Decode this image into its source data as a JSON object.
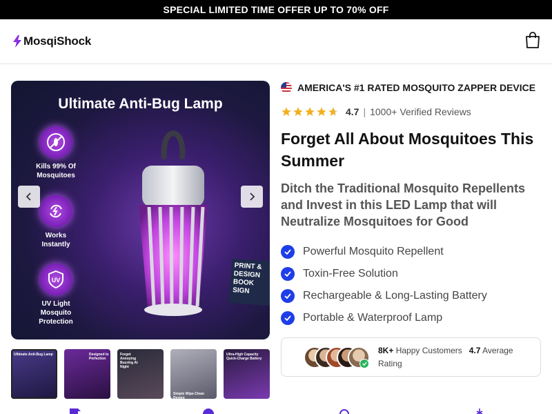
{
  "promo": {
    "text": "SPECIAL LIMITED TIME OFFER UP TO 70% OFF"
  },
  "header": {
    "logo_text": "MosqiShock",
    "logo_icon": "lightning-bolt-icon",
    "cart_icon": "shopping-bag-icon"
  },
  "gallery": {
    "title": "Ultimate Anti-Bug Lamp",
    "features": [
      {
        "label": "Kills 99% Of Mosquitoes",
        "icon": "mosquito-icon"
      },
      {
        "label": "Works Instantly",
        "icon": "refresh-icon"
      },
      {
        "label": "UV Light Mosquito Protection",
        "icon": "uv-shield-icon",
        "badge": "UV"
      }
    ],
    "book_text": "PRINT & DESIGN BOOK SIGN",
    "prev_icon": "chevron-left-icon",
    "next_icon": "chevron-right-icon"
  },
  "thumbnails": [
    {
      "label": "Ultimate Anti-Bug Lamp",
      "active": true,
      "color": "#3b2a6a"
    },
    {
      "label": "Designed to Perfection",
      "active": false,
      "color": "#4a1d6b"
    },
    {
      "label": "Forget Annoying Buzzing At Night",
      "active": false,
      "color": "#1d1d2a"
    },
    {
      "label": "Simple Wipe-Clean Design",
      "active": false,
      "color": "#6a6a7a"
    },
    {
      "label": "Ultra-High Capacity Quick-Charge Battery",
      "active": false,
      "color": "#3a2250"
    }
  ],
  "product": {
    "rated_text": "AMERICA'S #1 RATED MOSQUITO ZAPPER DEVICE",
    "rating": "4.7",
    "rating_value": 4.7,
    "rating_max": 5,
    "reviews_text": "1000+ Verified Reviews",
    "headline": "Forget All About Mosquitoes This Summer",
    "subheadline": "Ditch the Traditional Mosquito Repellents and Invest in this LED Lamp that will Neutralize Mosquitoes for Good",
    "benefits": [
      "Powerful Mosquito Repellent",
      "Toxin-Free Solution",
      "Rechargeable & Long-Lasting Battery",
      "Portable & Waterproof Lamp"
    ]
  },
  "social": {
    "customers_count": "8K+",
    "customers_label": "Happy Customers",
    "avg_rating": "4.7",
    "avg_label": "Average Rating"
  },
  "colors": {
    "accent_blue": "#1f3ee8",
    "star": "#f2b01e",
    "promo_bg": "#000000",
    "brand_purple": "#8a2be2"
  }
}
